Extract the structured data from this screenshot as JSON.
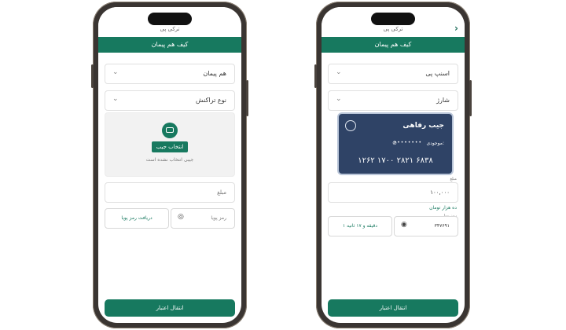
{
  "left": {
    "top_title": "ترکی پی",
    "header": "کیف هم پیمان",
    "dropdown_1": "هم پیمان",
    "dropdown_2": "نوع تراکنش",
    "select_wallet": "انتخاب جیب",
    "no_wallet": "جیبی انتخاب نشده است",
    "amount_placeholder": "مبلغ",
    "otp_button": "دریافت رمز پویا",
    "otp_placeholder": "رمز پویا",
    "primary_button": "انتقال اعتبار"
  },
  "right": {
    "top_title": "ترکی پی",
    "header": "کیف هم پیمان",
    "dropdown_1": "اسنپ پی",
    "dropdown_2": "شارژ",
    "card_title": "جیب رفاهی",
    "card_balance_label": "موجودی:",
    "card_balance_mask": "••••••••",
    "card_number": "۱۲۶۲ ۱۷۰۰ ۲۸۲۱ ۶۸۳۸",
    "amount_label": "مبلغ",
    "amount_value": "۱۰۰,۰۰۰",
    "amount_words": "ده هزار تومان",
    "otp_label": "رمز پویا",
    "otp_value": "۳۴۷۶۹۱",
    "timer_button": "۱ دقیقه و ۱۷ ثانیه",
    "primary_button": "انتقال اعتبار"
  }
}
